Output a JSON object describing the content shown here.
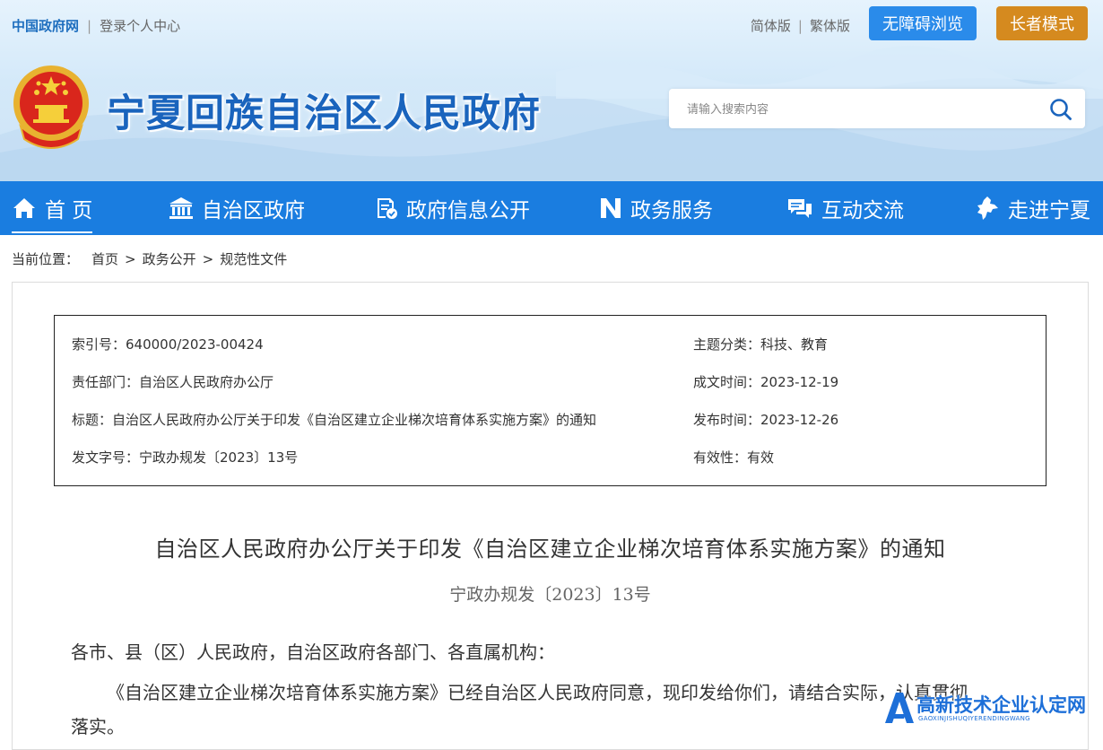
{
  "topbar": {
    "gov_link": "中国政府网",
    "separator": "|",
    "login_link": "登录个人中心",
    "simplified": "简体版",
    "traditional": "繁体版",
    "accessibility_button": "无障碍浏览",
    "elder_mode_button": "长者模式"
  },
  "header": {
    "site_title": "宁夏回族自治区人民政府",
    "search_placeholder": "请输入搜索内容",
    "search_value": ""
  },
  "nav": {
    "items": [
      {
        "label": "首 页",
        "icon": "home-icon",
        "active": true
      },
      {
        "label": "自治区政府",
        "icon": "government-building-icon"
      },
      {
        "label": "政府信息公开",
        "icon": "document-check-icon"
      },
      {
        "label": "政务服务",
        "icon": "service-n-icon"
      },
      {
        "label": "互动交流",
        "icon": "chat-bubble-icon"
      },
      {
        "label": "走进宁夏",
        "icon": "ningxia-map-icon"
      }
    ]
  },
  "breadcrumb": {
    "label": "当前位置：",
    "items": [
      "首页",
      "政务公开",
      "规范性文件"
    ],
    "separator": ">"
  },
  "meta": {
    "index_no": "索引号：640000/2023-00424",
    "department": "责任部门：自治区人民政府办公厅",
    "title": "标题：自治区人民政府办公厅关于印发《自治区建立企业梯次培育体系实施方案》的通知",
    "doc_no": "发文字号：宁政办规发〔2023〕13号",
    "topic": "主题分类：科技、教育",
    "created": "成文时间：2023-12-19",
    "published": "发布时间：2023-12-26",
    "validity": "有效性：有效"
  },
  "document": {
    "title": "自治区人民政府办公厅关于印发《自治区建立企业梯次培育体系实施方案》的通知",
    "number": "宁政办规发〔2023〕13号",
    "salutation": "各市、县（区）人民政府，自治区政府各部门、各直属机构：",
    "body_line1": "《自治区建立企业梯次培育体系实施方案》已经自治区人民政府同意，现印发给你们，请结合实际，认真贯彻",
    "body_line2": "落实。"
  },
  "watermark": {
    "text": "高新技术企业认定网",
    "pinyin": "GAOXINJISHUQIYERENDINGWANG"
  },
  "colors": {
    "nav_blue": "#1a7de0",
    "title_blue": "#1a64bd",
    "access_button": "#2a8bea",
    "elder_button": "#d58a1f"
  }
}
